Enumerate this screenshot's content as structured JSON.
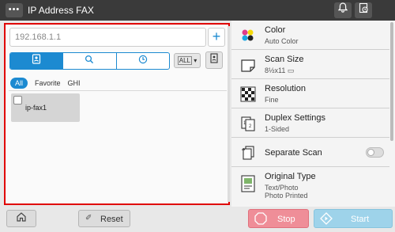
{
  "header": {
    "menu_label": "•••",
    "title": "IP Address FAX",
    "icons": [
      "bell-icon",
      "job-status-icon"
    ]
  },
  "address": {
    "placeholder": "192.168.1.1",
    "add_label": "+"
  },
  "tabs": [
    {
      "name": "address-book-icon",
      "active": true
    },
    {
      "name": "search-icon",
      "active": false
    },
    {
      "name": "history-icon",
      "active": false
    }
  ],
  "index_select": {
    "label": "ALL",
    "arrow": "▾"
  },
  "filters": {
    "all": "All",
    "favorite": "Favorite",
    "ghi": "GHI"
  },
  "destinations": [
    {
      "label": "ip-fax1",
      "checked": false
    }
  ],
  "settings": [
    {
      "label": "Color",
      "value": "Auto Color"
    },
    {
      "label": "Scan Size",
      "value": "8½x11"
    },
    {
      "label": "Resolution",
      "value": "Fine"
    },
    {
      "label": "Duplex Settings",
      "value": "1-Sided"
    },
    {
      "label": "Separate Scan",
      "toggle": false
    },
    {
      "label": "Original Type",
      "value": "Text/Photo",
      "value2": "Photo Printed"
    }
  ],
  "bottom": {
    "reset": "Reset",
    "stop": "Stop",
    "start": "Start"
  },
  "colors": {
    "accent": "#1c8ad1",
    "highlight_border": "#e00000",
    "stop": "#ef8e98",
    "start": "#9ed3ea"
  }
}
